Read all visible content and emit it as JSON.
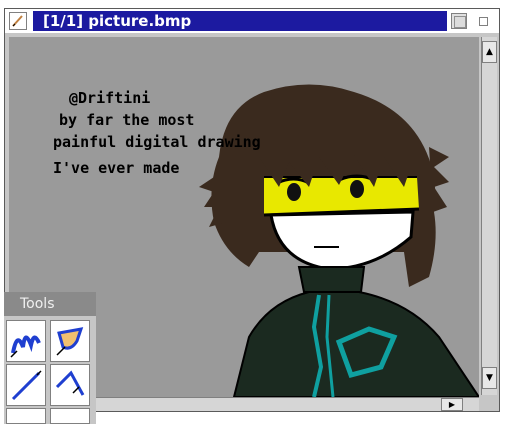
{
  "window": {
    "title": "[1/1] picture.bmp"
  },
  "canvas_text": {
    "line1": "@Driftini",
    "line2": "by far the most",
    "line3": "painful digital drawing",
    "line4": "I've ever made"
  },
  "scrollbars": {
    "up_arrow": "▲",
    "down_arrow": "▼",
    "right_arrow": "▶"
  },
  "tools": {
    "title": "Tools",
    "items": [
      "brush-icon",
      "fill-bucket-icon",
      "line-icon",
      "polyline-icon"
    ]
  },
  "colors": {
    "title_bar": "#1c1aa0",
    "canvas_bg": "#9a9a9a",
    "hair": "#3a2a1e",
    "visor": "#e8e800",
    "jacket": "#1b2a20",
    "accent": "#0fa0a0"
  }
}
